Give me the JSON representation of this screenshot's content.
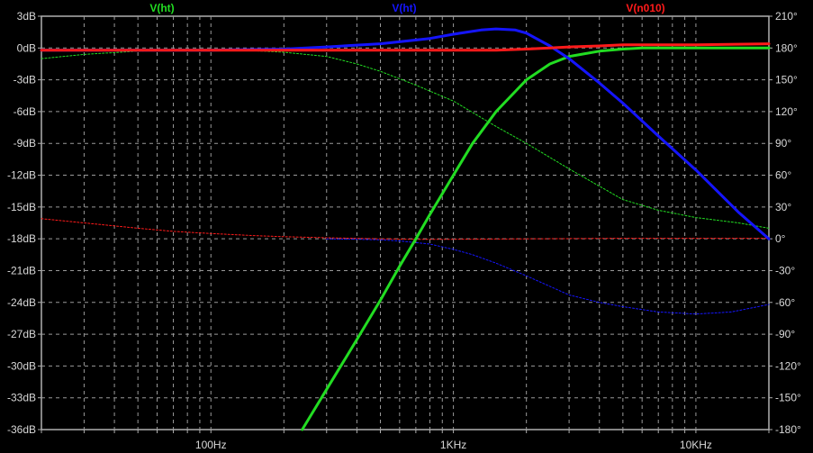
{
  "chart_data": {
    "type": "line",
    "x_scale": "log",
    "xlim_hz": [
      20,
      20000
    ],
    "ylim_db": [
      -36,
      3
    ],
    "ylim_deg": [
      -180,
      210
    ],
    "grid": true,
    "legend_position": "top",
    "legend": [
      {
        "label": "V(ht)",
        "color": "#22dd22"
      },
      {
        "label": "V(ht)",
        "color": "#1515ff"
      },
      {
        "label": "V(n010)",
        "color": "#ff1a1a"
      }
    ],
    "x_tick_labels": [
      {
        "value": 100,
        "label": "100Hz"
      },
      {
        "value": 1000,
        "label": "1KHz"
      },
      {
        "value": 10000,
        "label": "10KHz"
      }
    ],
    "y_left_ticks": [
      {
        "value": 3,
        "label": "3dB"
      },
      {
        "value": 0,
        "label": "0dB"
      },
      {
        "value": -3,
        "label": "-3dB"
      },
      {
        "value": -6,
        "label": "-6dB"
      },
      {
        "value": -9,
        "label": "-9dB"
      },
      {
        "value": -12,
        "label": "-12dB"
      },
      {
        "value": -15,
        "label": "-15dB"
      },
      {
        "value": -18,
        "label": "-18dB"
      },
      {
        "value": -21,
        "label": "-21dB"
      },
      {
        "value": -24,
        "label": "-24dB"
      },
      {
        "value": -27,
        "label": "-27dB"
      },
      {
        "value": -30,
        "label": "-30dB"
      },
      {
        "value": -33,
        "label": "-33dB"
      },
      {
        "value": -36,
        "label": "-36dB"
      }
    ],
    "y_right_ticks": [
      {
        "value": 210,
        "label": "210°"
      },
      {
        "value": 180,
        "label": "180°"
      },
      {
        "value": 150,
        "label": "150°"
      },
      {
        "value": 120,
        "label": "120°"
      },
      {
        "value": 90,
        "label": "90°"
      },
      {
        "value": 60,
        "label": "60°"
      },
      {
        "value": 30,
        "label": "30°"
      },
      {
        "value": 0,
        "label": "0°"
      },
      {
        "value": -30,
        "label": "-30°"
      },
      {
        "value": -60,
        "label": "-60°"
      },
      {
        "value": -90,
        "label": "-90°"
      },
      {
        "value": -120,
        "label": "-120°"
      },
      {
        "value": -150,
        "label": "-150°"
      },
      {
        "value": -180,
        "label": "-180°"
      }
    ],
    "series": [
      {
        "color": "#22dd22",
        "kind": "magnitude_db",
        "dashed": false,
        "x": [
          238,
          300,
          400,
          500,
          600,
          700,
          800,
          1000,
          1200,
          1500,
          2000,
          2500,
          3000,
          4000,
          5000,
          6000,
          8000,
          10000,
          14000,
          20000
        ],
        "y": [
          -36,
          -32.2,
          -27.5,
          -23.8,
          -20.6,
          -18,
          -15.7,
          -12,
          -9,
          -6,
          -3,
          -1.5,
          -0.8,
          -0.3,
          -0.1,
          0,
          0,
          0,
          0,
          0
        ]
      },
      {
        "color": "#22dd22",
        "kind": "phase_deg",
        "dashed": true,
        "x": [
          20,
          30,
          50,
          70,
          100,
          150,
          200,
          300,
          400,
          500,
          700,
          1000,
          1500,
          2000,
          3000,
          5000,
          7000,
          10000,
          15000,
          20000
        ],
        "y": [
          170,
          174,
          177,
          178,
          178,
          177.5,
          176,
          172,
          165,
          158,
          145,
          130,
          106,
          90,
          66,
          37,
          27,
          20,
          15,
          10
        ]
      },
      {
        "color": "#1515ff",
        "kind": "magnitude_db",
        "dashed": false,
        "x": [
          20,
          100,
          200,
          300,
          500,
          800,
          1000,
          1300,
          1500,
          1800,
          2000,
          2500,
          3000,
          4000,
          5000,
          7000,
          10000,
          15000,
          20000
        ],
        "y": [
          -0.2,
          -0.2,
          -0.1,
          0.1,
          0.4,
          0.9,
          1.3,
          1.7,
          1.8,
          1.7,
          1.4,
          0.2,
          -1,
          -3.3,
          -5.2,
          -8.3,
          -11.5,
          -15.5,
          -18
        ]
      },
      {
        "color": "#1515ff",
        "kind": "phase_deg",
        "dashed": true,
        "x": [
          300,
          400,
          500,
          600,
          800,
          1000,
          1200,
          1500,
          2000,
          3000,
          4000,
          5000,
          7000,
          10000,
          14000,
          20000
        ],
        "y": [
          0,
          -0.5,
          -1,
          -2,
          -5,
          -10,
          -15,
          -23,
          -35,
          -53,
          -60,
          -64,
          -69,
          -71,
          -69,
          -62
        ]
      },
      {
        "color": "#ff1a1a",
        "kind": "magnitude_db",
        "dashed": false,
        "x": [
          20,
          100,
          500,
          1000,
          1500,
          2000,
          2500,
          3000,
          4000,
          5000,
          10000,
          20000
        ],
        "y": [
          -0.2,
          -0.2,
          -0.2,
          -0.2,
          -0.2,
          -0.1,
          0,
          0.1,
          0.2,
          0.3,
          0.3,
          0.4
        ]
      },
      {
        "color": "#ff1a1a",
        "kind": "phase_deg",
        "dashed": true,
        "x": [
          20,
          30,
          50,
          70,
          100,
          150,
          200,
          300,
          500,
          700,
          1000,
          2000,
          5000,
          10000,
          20000
        ],
        "y": [
          19,
          15,
          10,
          7,
          5,
          3,
          2,
          1,
          0,
          -0.5,
          -0.5,
          0,
          0.5,
          0.5,
          0.5
        ]
      }
    ]
  }
}
